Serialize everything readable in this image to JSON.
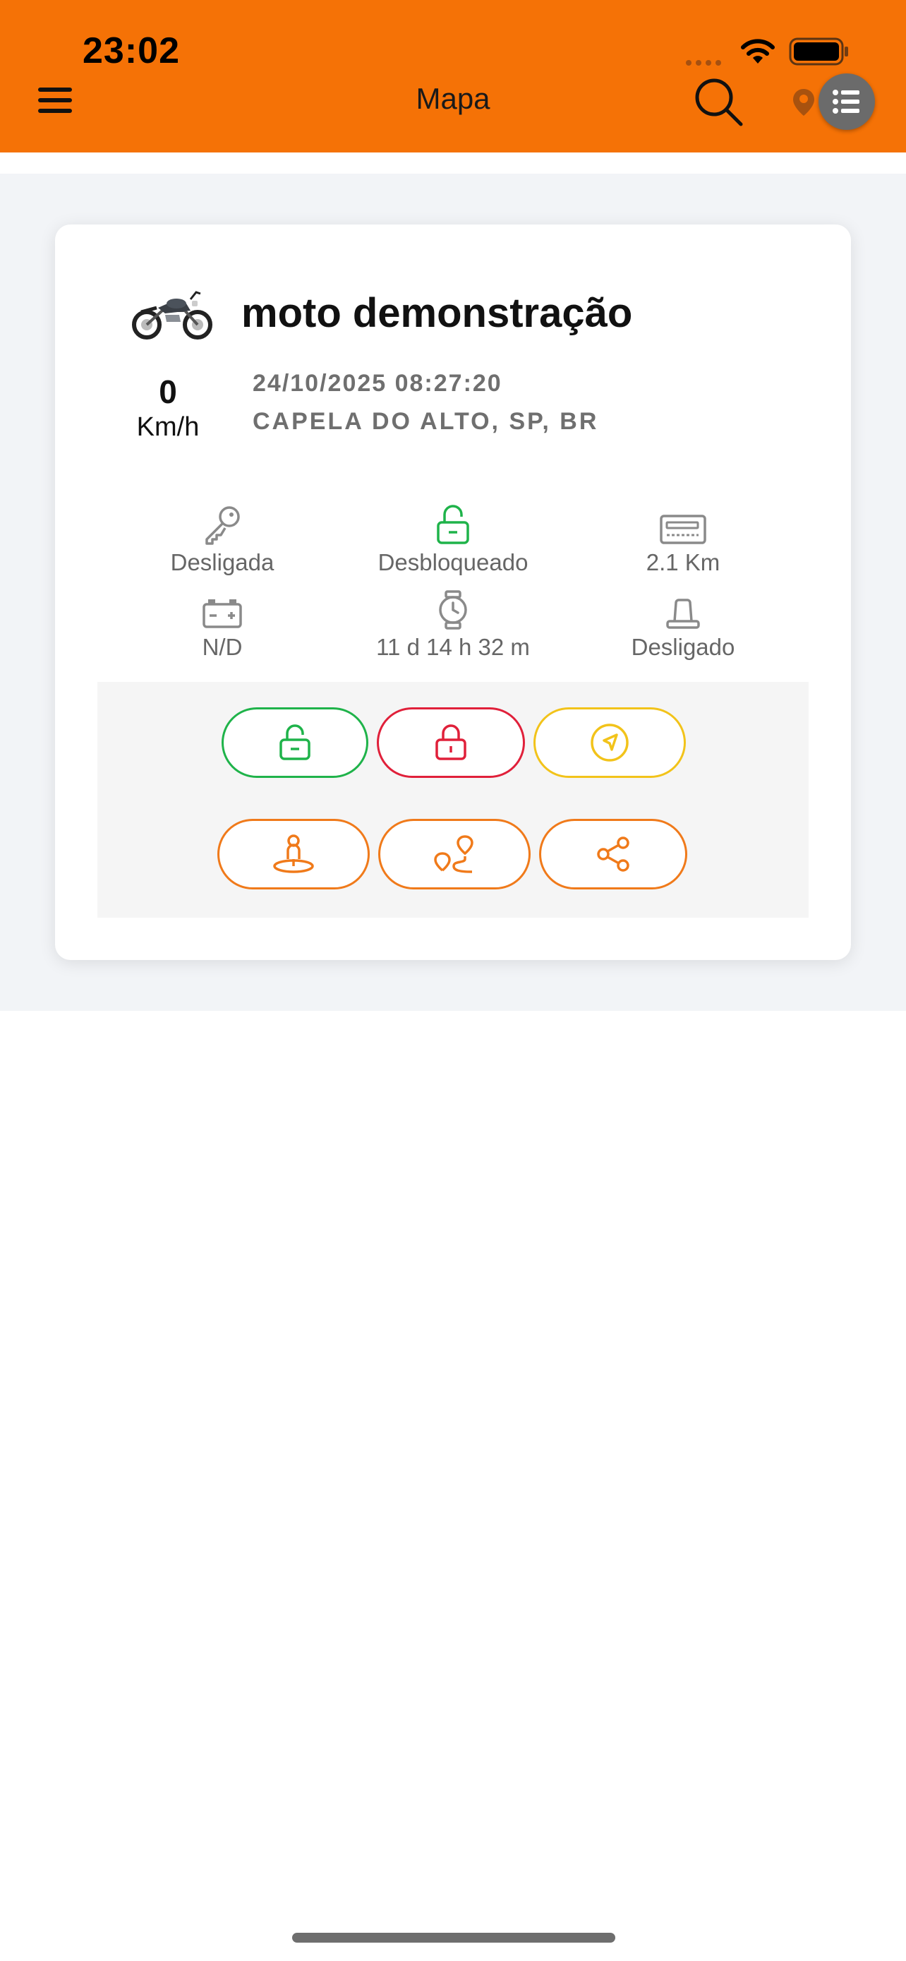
{
  "status_bar": {
    "time": "23:02"
  },
  "header": {
    "title": "Mapa",
    "icons": [
      "menu-icon",
      "search-icon",
      "location-pin-icon",
      "list-icon"
    ],
    "background_color": "#f57206"
  },
  "vehicle_card": {
    "name": "moto demonstração",
    "speed": "0",
    "speed_unit": "Km/h",
    "last_update": "24/10/2025 08:27:20",
    "location": "CAPELA DO ALTO, SP, BR",
    "stats": [
      {
        "icon": "key-icon",
        "label": "Desligada"
      },
      {
        "icon": "unlocked-padlock-icon",
        "label": "Desbloqueado",
        "color": "#1fb34a"
      },
      {
        "icon": "odometer-icon",
        "label": "2.1 Km"
      },
      {
        "icon": "battery-icon",
        "label": "N/D"
      },
      {
        "icon": "stopwatch-icon",
        "label": "11 d 14 h 32 m"
      },
      {
        "icon": "siren-icon",
        "label": "Desligado"
      }
    ],
    "actions": [
      {
        "icon": "unlock-icon",
        "color": "#1fb34a"
      },
      {
        "icon": "lock-icon",
        "color": "#e0203a"
      },
      {
        "icon": "navigate-icon",
        "color": "#f2c31a"
      },
      {
        "icon": "person-pin-icon",
        "color": "#f07a1a"
      },
      {
        "icon": "route-icon",
        "color": "#f07a1a"
      },
      {
        "icon": "share-icon",
        "color": "#f07a1a"
      }
    ]
  }
}
